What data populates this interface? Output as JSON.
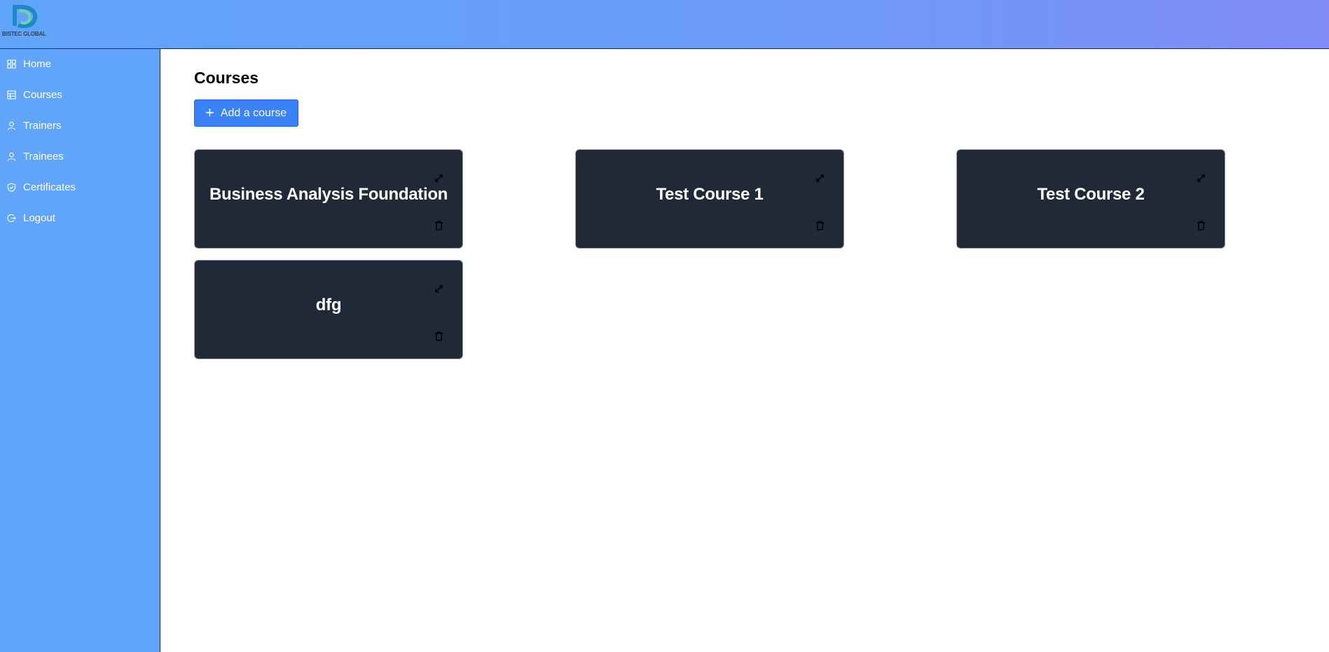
{
  "brand": {
    "logo_text": "BISTEC GLOBAL",
    "logo_icon": "bistec-logo-icon"
  },
  "sidebar": {
    "items": [
      {
        "label": "Home",
        "icon": "grid-icon"
      },
      {
        "label": "Courses",
        "icon": "table-icon"
      },
      {
        "label": "Trainers",
        "icon": "user-icon"
      },
      {
        "label": "Trainees",
        "icon": "user-icon"
      },
      {
        "label": "Certificates",
        "icon": "shield-check-icon"
      },
      {
        "label": "Logout",
        "icon": "logout-icon"
      }
    ]
  },
  "main": {
    "title": "Courses",
    "add_button_label": "Add a course",
    "courses": [
      {
        "title": "Business Analysis Foundation"
      },
      {
        "title": "Test Course 1"
      },
      {
        "title": "Test Course 2"
      },
      {
        "title": "dfg"
      }
    ]
  },
  "colors": {
    "topbar_start": "#60a5fa",
    "topbar_end": "#818cf8",
    "sidebar": "#60a5fa",
    "button": "#3b82f6",
    "card": "#1f2937"
  }
}
